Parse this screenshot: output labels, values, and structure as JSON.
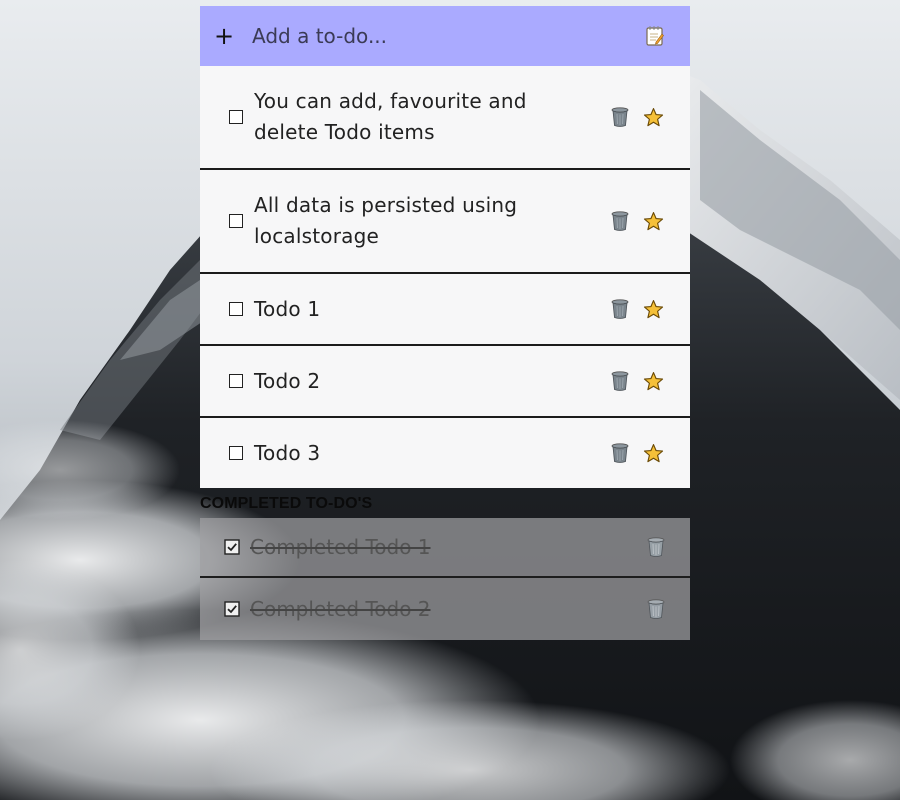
{
  "add_bar": {
    "plus_label": "+",
    "placeholder": "Add a to-do...",
    "icon": "notepad-icon"
  },
  "todos": [
    {
      "line1": "You can add, favourite and",
      "line2": "delete Todo items"
    },
    {
      "line1": "All data is persisted using",
      "line2": "localstorage"
    },
    {
      "line1": "Todo 1"
    },
    {
      "line1": "Todo 2"
    },
    {
      "line1": "Todo 3"
    }
  ],
  "completed": {
    "heading": "COMPLETED TO-DO'S",
    "items": [
      {
        "label": "Completed Todo 1"
      },
      {
        "label": "Completed Todo 2"
      }
    ]
  },
  "colors": {
    "add_bar": "#aaaaff",
    "todo_bg": "#f7f7f8",
    "star": "#f5c038",
    "trash": "#707a82"
  },
  "icons": {
    "todo_actions": [
      "trash-icon",
      "star-icon"
    ],
    "completed_actions": [
      "trash-icon"
    ],
    "checkbox": "checkbox-icon"
  }
}
